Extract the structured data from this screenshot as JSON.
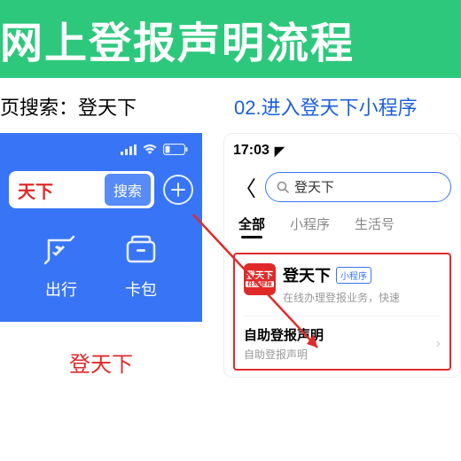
{
  "banner": {
    "title": "网上登报声明流程"
  },
  "step1": {
    "num": "",
    "text": "页搜索：登天下"
  },
  "step2": {
    "num": "02.",
    "text": "进入登天下小程序"
  },
  "left": {
    "search_value": "天下",
    "search_btn": "搜索",
    "icons": {
      "travel": "出行",
      "card": "卡包"
    },
    "caption": "登天下"
  },
  "right": {
    "time": "17:03",
    "search_value": "登天下",
    "tabs": {
      "all": "全部",
      "mini": "小程序",
      "life": "生活号"
    },
    "result": {
      "icon_top": "登天下",
      "icon_bottom": "在线登报",
      "title": "登天下",
      "tag": "小程序",
      "desc": "在线办理登报业务，快速",
      "sub_title": "自助登报声明",
      "sub_desc": "自助登报声明"
    }
  }
}
